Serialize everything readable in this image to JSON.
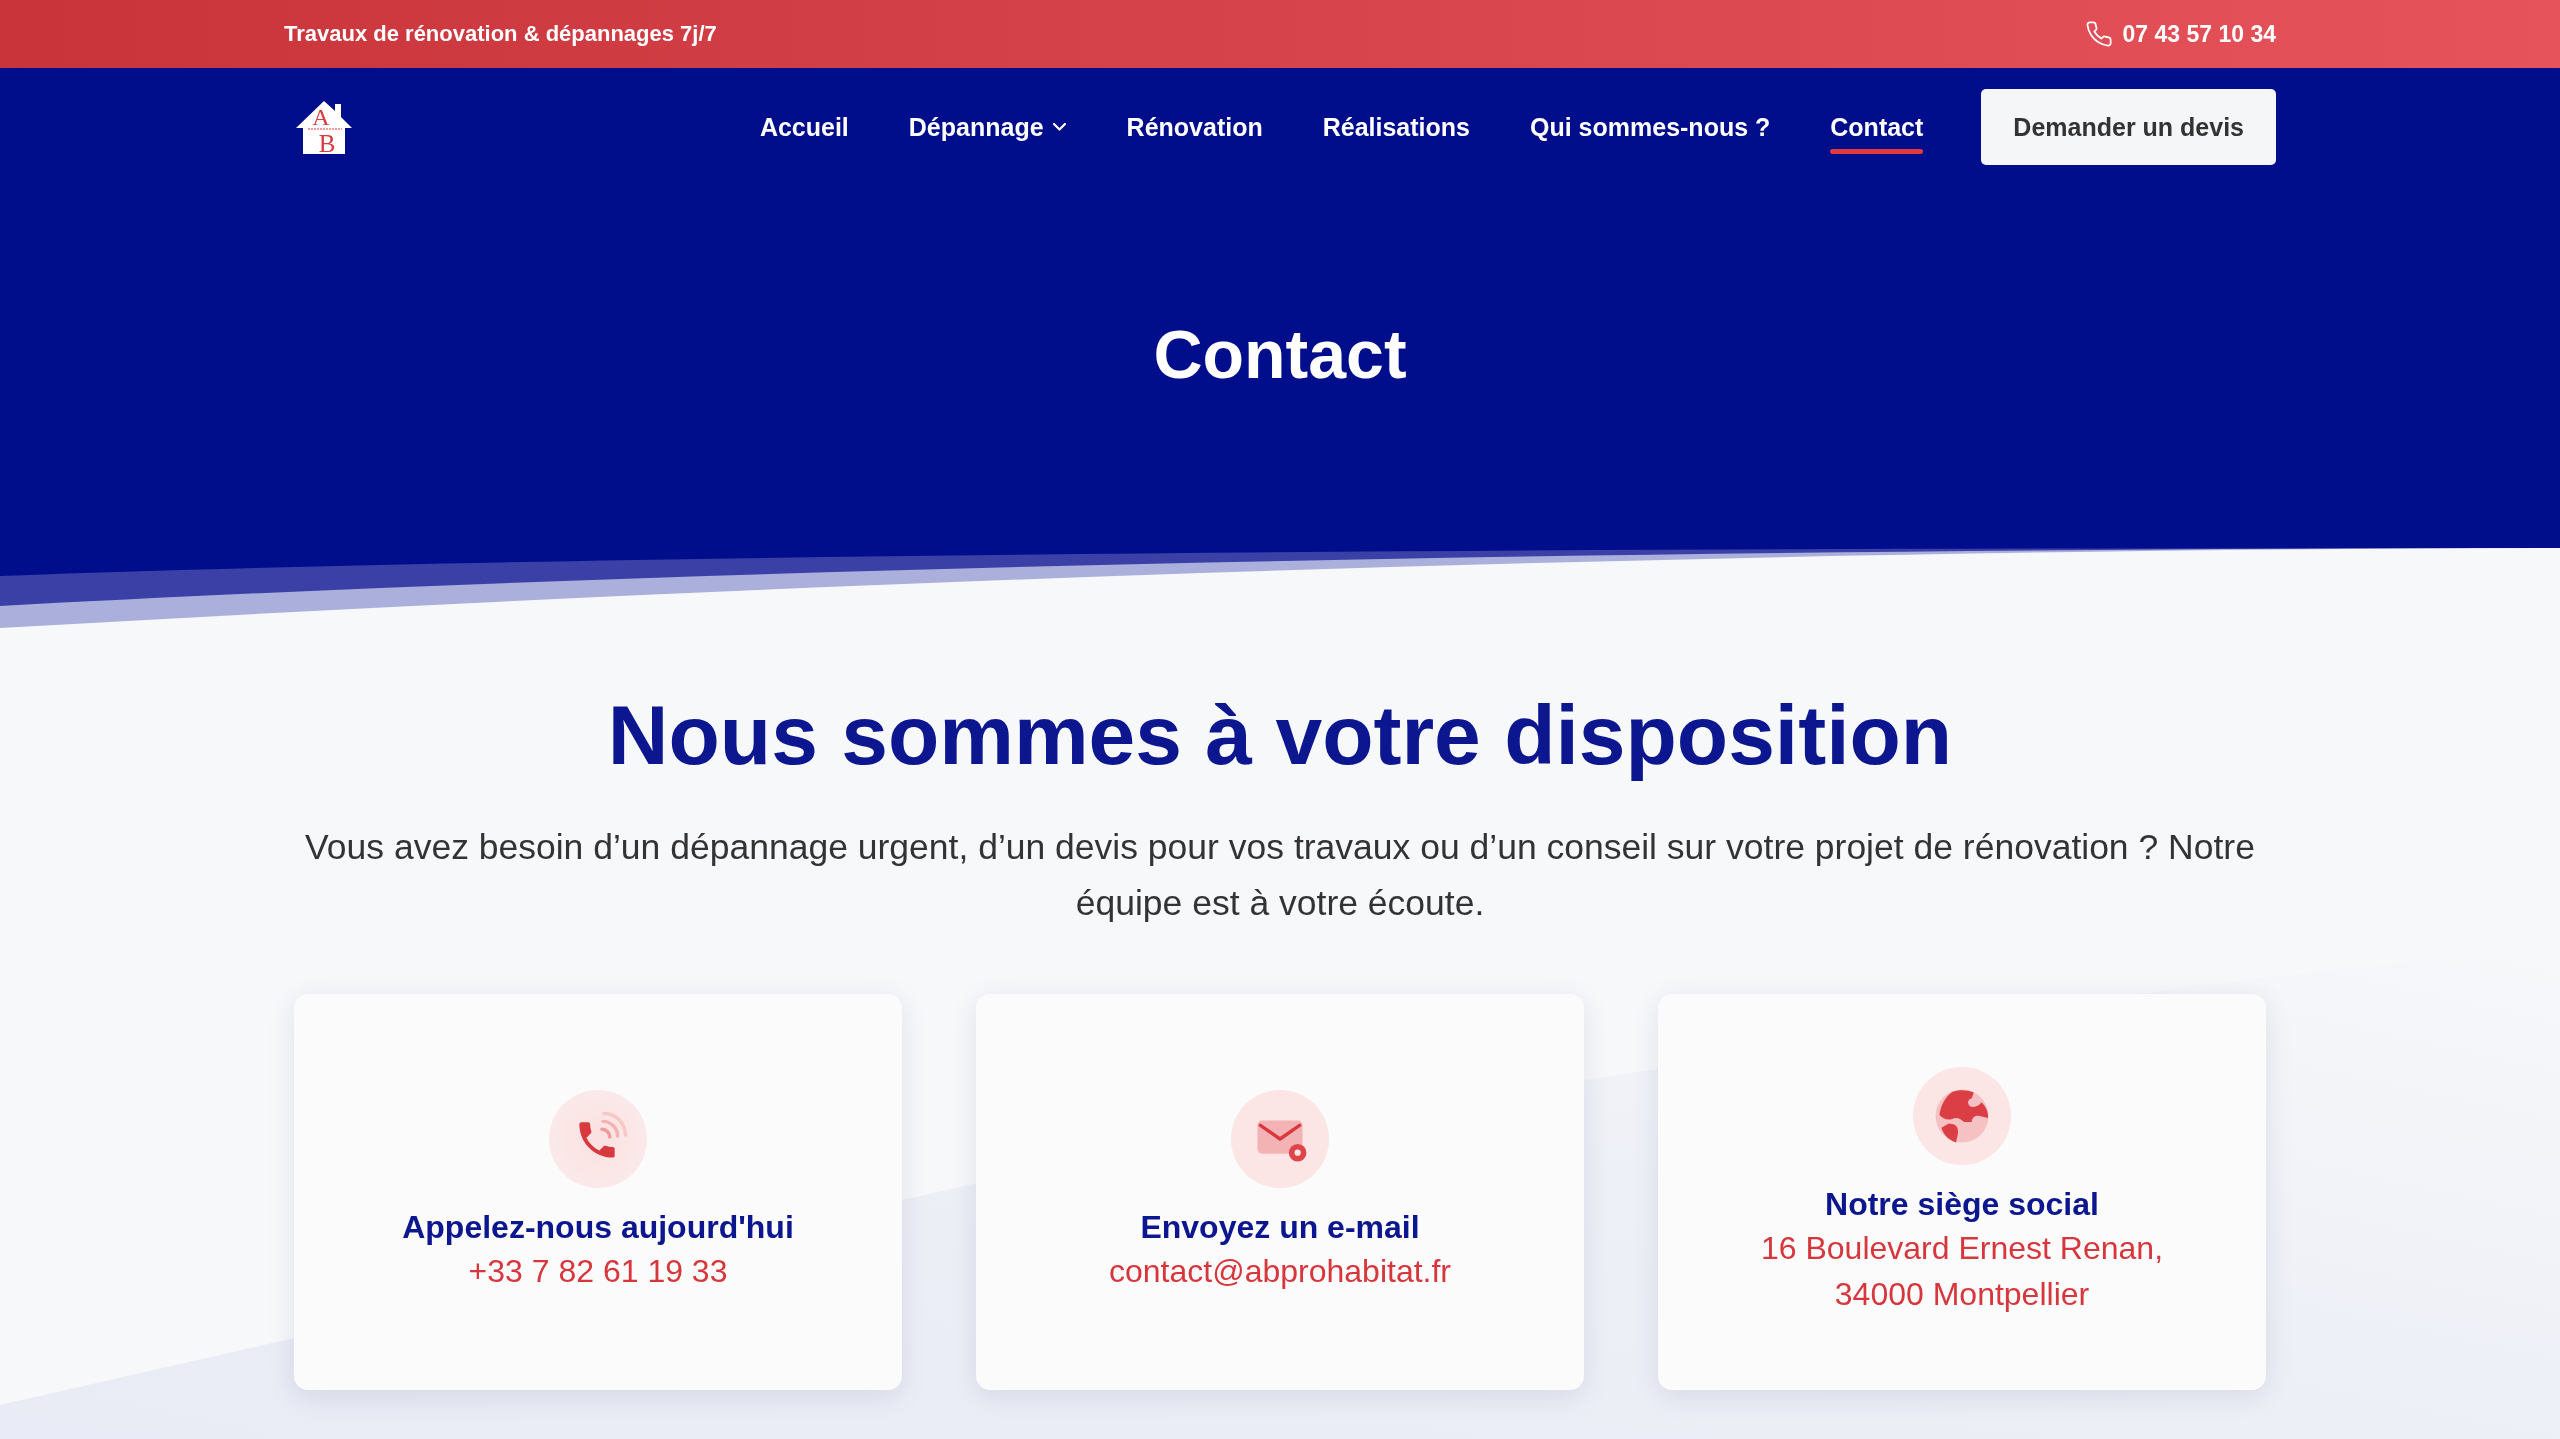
{
  "top_bar": {
    "tagline": "Travaux de rénovation & dépannages 7j/7",
    "phone": "07 43 57 10 34"
  },
  "nav": {
    "logo": {
      "letters": [
        "A",
        "B"
      ]
    },
    "items": [
      {
        "label": "Accueil",
        "selected": false,
        "dropdown": false
      },
      {
        "label": "Dépannage",
        "selected": false,
        "dropdown": true
      },
      {
        "label": "Rénovation",
        "selected": false,
        "dropdown": false
      },
      {
        "label": "Réalisations",
        "selected": false,
        "dropdown": false
      },
      {
        "label": "Qui sommes-nous ?",
        "selected": false,
        "dropdown": false
      },
      {
        "label": "Contact",
        "selected": true,
        "dropdown": false
      }
    ],
    "cta": "Demander un devis"
  },
  "hero": {
    "title": "Contact"
  },
  "intro": {
    "heading": "Nous sommes à votre disposition",
    "text": "Vous avez besoin d’un dépannage urgent, d’un devis pour vos travaux ou d’un conseil sur votre projet de rénovation ? Notre équipe est à votre écoute."
  },
  "cards": [
    {
      "kind": "phone",
      "title": "Appelez-nous aujourd'hui",
      "lines": [
        "+33 7 82 61 19 33"
      ]
    },
    {
      "kind": "email",
      "title": "Envoyez un e-mail",
      "lines": [
        "contact@abprohabitat.fr"
      ]
    },
    {
      "kind": "address",
      "title": "Notre siège social",
      "lines": [
        "16 Boulevard Ernest Renan,",
        "34000 Montpellier"
      ]
    }
  ]
}
